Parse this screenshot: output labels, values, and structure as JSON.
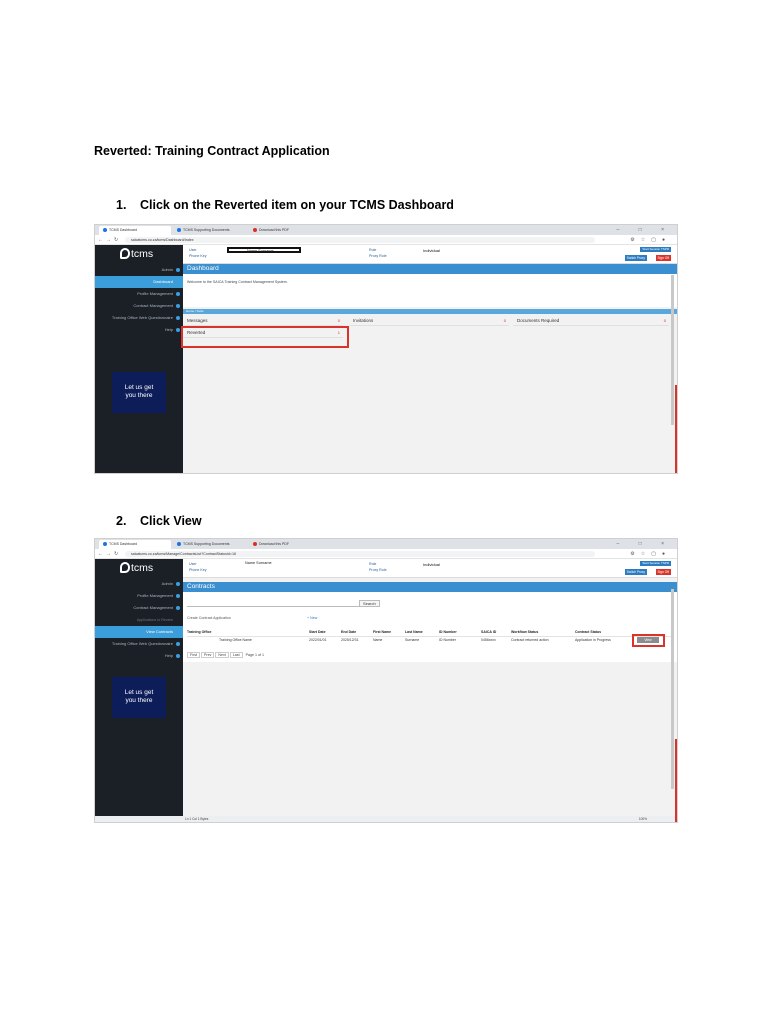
{
  "doc_title": "Reverted: Training Contract Application",
  "steps": [
    {
      "num": "1.",
      "text": "Click on the Reverted item on your TCMS Dashboard"
    },
    {
      "num": "2.",
      "text": "Click View"
    }
  ],
  "browser": {
    "tab1": {
      "title": "TCMS Dashboard",
      "tab2": "TCMS Supporting Documents",
      "tab3": "Download this PDF"
    },
    "tab2": {
      "title": "TCMS Dashboard",
      "tab2": "TCMS Supporting Documents",
      "tab3": "Download this PDF"
    },
    "url1": "saicatcms.co.za/tcms/Dashboard/Index",
    "url2": "saicatcms.co.za/tcms/Manage/ContractsList?ContractStatusId=16",
    "controls": "– □ ×",
    "status_left": "Ln 1 Col 1 Bytes",
    "status_right": "100%"
  },
  "app": {
    "logo": "tcms",
    "promo_line1": "Let us get",
    "promo_line2": "you there",
    "user_label": "User",
    "phone_label": "Phone Key",
    "role_label": "Role",
    "proxy_label": "Proxy Role",
    "username": "Name Surname",
    "role_value": "Individual",
    "btn_switch": "Switch Proxy",
    "btn_logoff": "Sign Off",
    "top_btn": "Start Session TSPR",
    "menu1": [
      "Admin",
      "Dashboard",
      "Profile Management",
      "Contract Management",
      "Training Office Web Questionnaire",
      "Help"
    ],
    "menu2": [
      "Admin",
      "Profile Management",
      "Contract Management",
      "Applications to Review",
      "View Contracts",
      "Training Office Web Questionnaire",
      "Help"
    ]
  },
  "dashboard": {
    "header": "Dashboard",
    "welcome": "Welcome to the SAICA Training Contract Management System.",
    "toolbar": "Home / Tools",
    "messages": "Messages",
    "messages_count": "0",
    "invitations": "Invitations",
    "invitations_count": "0",
    "docs_required": "Documents Required",
    "docs_count": "0",
    "reverted": "Reverted",
    "reverted_count": "1"
  },
  "contracts": {
    "header": "Contracts",
    "search_btn": "Search",
    "create_label": "Create Contract Application",
    "create_link": "+ New",
    "columns": [
      "Training Office",
      "Start Date",
      "End Date",
      "First Name",
      "Last Name",
      "ID Number",
      "SAICA ID",
      "Workflow Status",
      "Contract Status"
    ],
    "row": [
      "Training Office Name",
      "2022/01/01",
      "2025/12/31",
      "Name",
      "Surname",
      "ID Number",
      "0456xxxx",
      "Contract returned action",
      "Application in Progress"
    ],
    "view_btn": "View",
    "pager": [
      "First",
      "Prev",
      "Next",
      "Last"
    ],
    "pager_info": "Page 1 of 1"
  }
}
